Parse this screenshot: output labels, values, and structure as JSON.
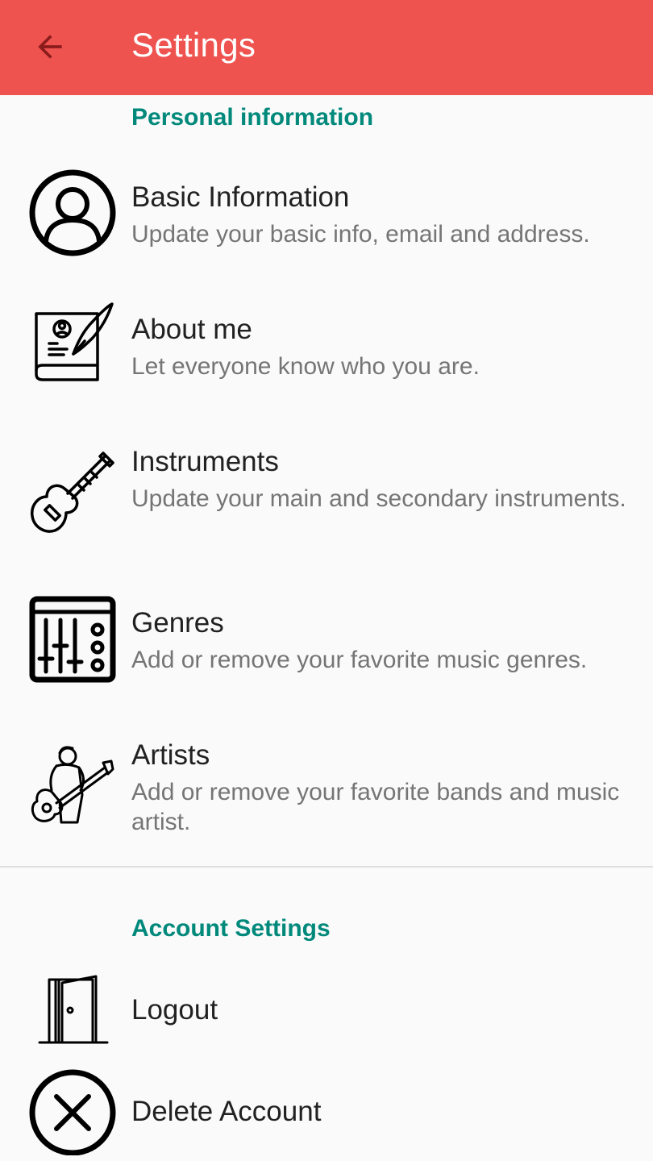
{
  "app_bar": {
    "title": "Settings",
    "back_icon": "arrow-back-icon",
    "background_color": "#ef5350",
    "back_icon_color": "#8b1c1c"
  },
  "sections": [
    {
      "header": "Personal information",
      "items": [
        {
          "title": "Basic Information",
          "subtitle": "Update your basic info, email and address.",
          "icon": "user-circle-icon"
        },
        {
          "title": "About me",
          "subtitle": "Let everyone know who you are.",
          "icon": "profile-book-quill-icon"
        },
        {
          "title": "Instruments",
          "subtitle": "Update your main and secondary instruments.",
          "icon": "guitar-icon"
        },
        {
          "title": "Genres",
          "subtitle": "Add or remove your favorite music genres.",
          "icon": "mixer-equalizer-icon"
        },
        {
          "title": "Artists",
          "subtitle": "Add or remove your favorite bands and music artist.",
          "icon": "guitarist-icon"
        }
      ]
    },
    {
      "header": "Account Settings",
      "items": [
        {
          "title": "Logout",
          "icon": "door-exit-icon"
        },
        {
          "title": "Delete Account",
          "icon": "close-circle-icon"
        }
      ]
    }
  ],
  "colors": {
    "accent": "#00897b",
    "primary_text": "#212121",
    "secondary_text": "#757575",
    "background": "#fafafa",
    "divider": "#dedede"
  }
}
